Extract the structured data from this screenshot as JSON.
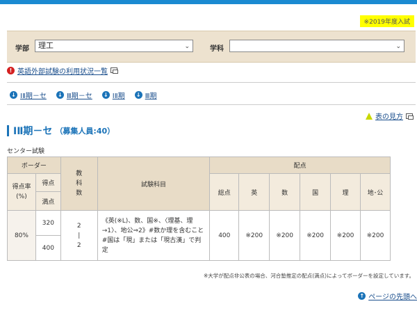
{
  "year_badge": "※2019年度入試",
  "search": {
    "faculty_label": "学部",
    "faculty_value": "理工",
    "department_label": "学科",
    "department_value": ""
  },
  "notice_link": "英語外部試験の利用状況一覧",
  "jump_links": [
    "ⅠⅡ期－セ",
    "Ⅲ期－セ",
    "ⅠⅡ期",
    "Ⅲ期"
  ],
  "guide_link": "表の見方",
  "section": {
    "title": "ⅠⅡ期－セ",
    "subtitle": "（募集人員:40）",
    "exam_type": "センター試験"
  },
  "table": {
    "border_header": "ボーダー",
    "rate_label": "得点率\n(%)",
    "score_label": "得点",
    "full_label": "満点",
    "subjects_count_header": [
      "教",
      "科",
      "数"
    ],
    "subjects_header": "試験科目",
    "allocation_header": "配点",
    "allocation_columns": [
      "総点",
      "英",
      "数",
      "国",
      "理",
      "地･公"
    ],
    "row": {
      "rate": "80%",
      "score": "320",
      "full": "400",
      "count": [
        "2",
        "|",
        "2"
      ],
      "subjects": "《英(※L)、数、国※、〈理基、理→1〉、地公⇒2》#数か理を含むこと#国は「現」または「現古漢」で判定",
      "total": "400",
      "allocations": [
        "※200",
        "※200",
        "※200",
        "※200",
        "※200"
      ]
    }
  },
  "footnote": "※大学が配点非公表の場合、河合塾推定の配点(満点)によってボーダーを設定しています。",
  "page_top_link": "ページの先頭へ"
}
